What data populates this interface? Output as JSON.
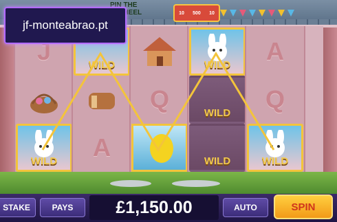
{
  "watermark": {
    "text": "jf-monteabrao.pt"
  },
  "game_banner": {
    "line1": "PIN THE",
    "line2": "R WHEEL"
  },
  "wheel_labels": [
    "10",
    "500",
    "10"
  ],
  "reels": [
    {
      "symbols": [
        "J",
        "",
        ""
      ]
    },
    {
      "symbols": [
        "WILD",
        "",
        "A"
      ]
    },
    {
      "symbols": [
        "",
        "Q",
        "bonus"
      ]
    },
    {
      "symbols": [
        "WILD",
        "WILD",
        "WILD"
      ]
    },
    {
      "symbols": [
        "A",
        "Q",
        "WILD"
      ]
    }
  ],
  "wild_label": "WILD",
  "controls": {
    "stake_label": "STAKE",
    "pays_label": "PAYS",
    "balance": "£1,150.00",
    "auto_label": "AUTO",
    "spin_label": "SPIN"
  },
  "colors": {
    "wild_gold": "#f3c43b",
    "spin_orange": "#f29a18",
    "bar_purple": "#2b1f5a"
  }
}
